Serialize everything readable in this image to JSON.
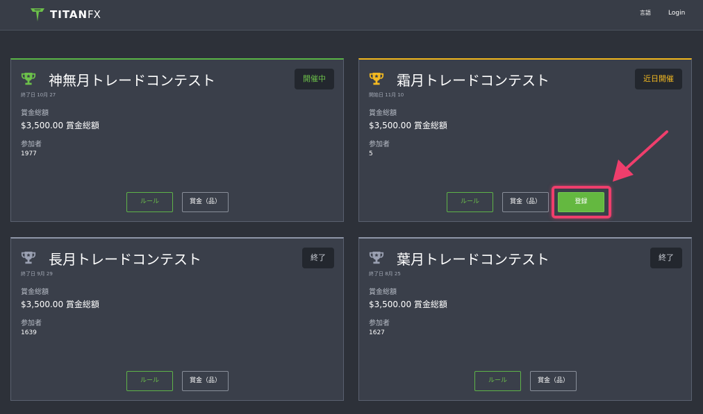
{
  "header": {
    "logo_text": "TITAN",
    "logo_text_suffix": "FX",
    "language_label": "言語",
    "login_label": "Login"
  },
  "contests": [
    {
      "title": "神無月トレードコンテスト",
      "date_label": "終了日 10月 27",
      "status": "開催中",
      "prize_label": "賞金総額",
      "prize_value": "$3,500.00 賞金総額",
      "participants_label": "参加者",
      "participants": "1977",
      "rules_label": "ルール",
      "prize_button_label": "賞金（品）"
    },
    {
      "title": "霜月トレードコンテスト",
      "date_label": "開始日 11月 10",
      "status": "近日開催",
      "prize_label": "賞金総額",
      "prize_value": "$3,500.00 賞金総額",
      "participants_label": "参加者",
      "participants": "5",
      "rules_label": "ルール",
      "prize_button_label": "賞金（品）",
      "register_label": "登録"
    },
    {
      "title": "長月トレードコンテスト",
      "date_label": "終了日 9月 29",
      "status": "終了",
      "prize_label": "賞金総額",
      "prize_value": "$3,500.00 賞金総額",
      "participants_label": "参加者",
      "participants": "1639",
      "rules_label": "ルール",
      "prize_button_label": "賞金（品）"
    },
    {
      "title": "葉月トレードコンテスト",
      "date_label": "終了日 8月 25",
      "status": "終了",
      "prize_label": "賞金総額",
      "prize_value": "$3,500.00 賞金総額",
      "participants_label": "参加者",
      "participants": "1627",
      "rules_label": "ルール",
      "prize_button_label": "賞金（品）"
    }
  ],
  "colors": {
    "background": "#2d3139",
    "card": "#3a3f4a",
    "active_green": "#6cc04a",
    "upcoming_yellow": "#f3b921",
    "ended_grey": "#8f96a8",
    "annotation_pink": "#ef3e6c"
  },
  "icons": {
    "logo": "titan-shield-icon",
    "trophy": "trophy-icon",
    "annotation": "arrow-icon"
  }
}
